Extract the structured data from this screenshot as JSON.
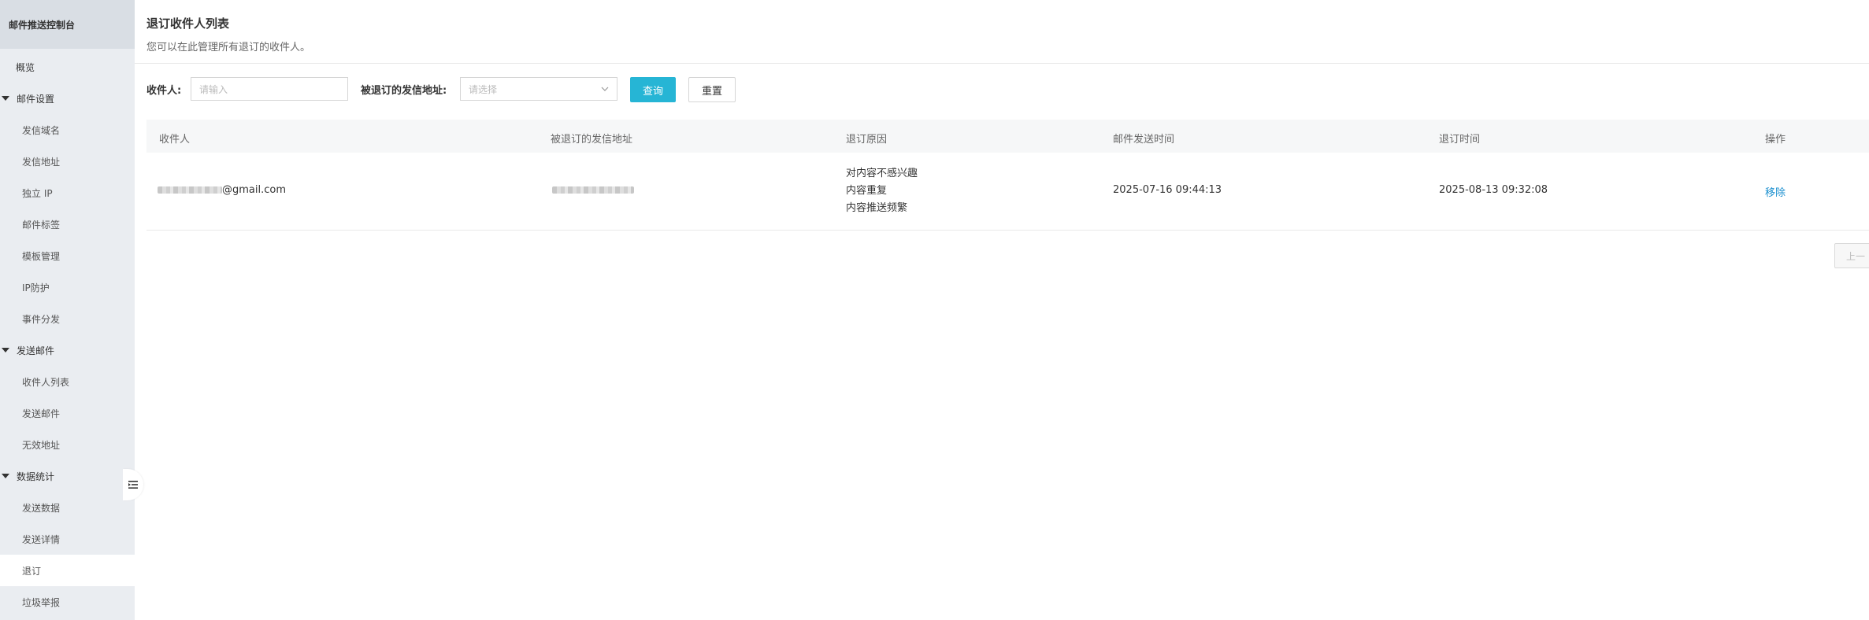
{
  "sidebar": {
    "title": "邮件推送控制台",
    "overview": "概览",
    "groups": [
      {
        "label": "邮件设置",
        "items": [
          "发信域名",
          "发信地址",
          "独立 IP",
          "邮件标签",
          "模板管理",
          "IP防护",
          "事件分发"
        ]
      },
      {
        "label": "发送邮件",
        "items": [
          "收件人列表",
          "发送邮件",
          "无效地址"
        ]
      },
      {
        "label": "数据统计",
        "items": [
          "发送数据",
          "发送详情",
          "退订",
          "垃圾举报"
        ]
      }
    ],
    "active_item": "退订"
  },
  "page": {
    "title": "退订收件人列表",
    "description": "您可以在此管理所有退订的收件人。"
  },
  "filters": {
    "recipient_label": "收件人:",
    "recipient_placeholder": "请输入",
    "sender_label": "被退订的发信地址:",
    "sender_placeholder": "请选择",
    "search_button": "查询",
    "reset_button": "重置"
  },
  "table": {
    "columns": [
      "收件人",
      "被退订的发信地址",
      "退订原因",
      "邮件发送时间",
      "退订时间",
      "操作"
    ],
    "rows": [
      {
        "recipient_suffix": "@gmail.com",
        "reasons": [
          "对内容不感兴趣",
          "内容重复",
          "内容推送频繁"
        ],
        "sent_time": "2025-07-16 09:44:13",
        "unsubscribe_time": "2025-08-13 09:32:08",
        "action": "移除"
      }
    ]
  },
  "pagination": {
    "prev_label": "上一"
  },
  "colors": {
    "primary": "#26b5d5",
    "link": "#1a8fcf",
    "sidebar_bg": "#eaedf1"
  }
}
